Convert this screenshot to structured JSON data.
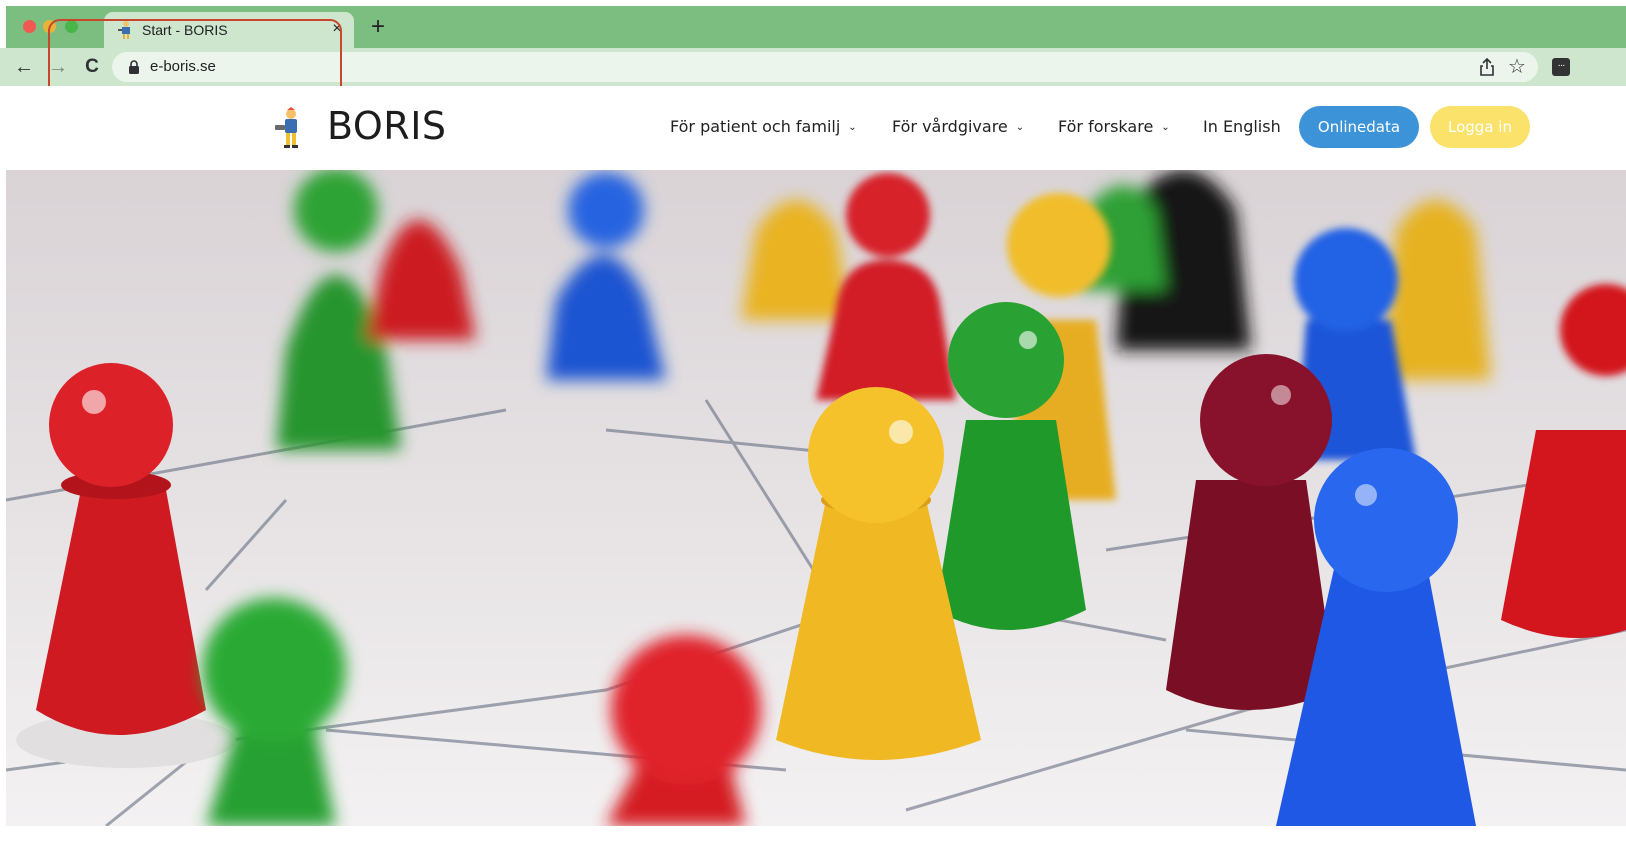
{
  "browser": {
    "tab": {
      "title": "Start - BORIS",
      "close": "×"
    },
    "new_tab": "+",
    "nav": {
      "back": "←",
      "forward": "→",
      "reload": "C"
    },
    "address": {
      "url": "e-boris.se"
    },
    "star": "☆",
    "extension": "···",
    "colors": {
      "chrome": "#7cbe80",
      "toolbar": "#cde6cd",
      "annotation": "#c8462b"
    }
  },
  "site": {
    "logo_text": "BORIS",
    "menu": [
      {
        "label": "För patient och familj",
        "chevron": "⌄"
      },
      {
        "label": "För vårdgivare",
        "chevron": "⌄"
      },
      {
        "label": "För forskare",
        "chevron": "⌄"
      },
      {
        "label": "In English"
      }
    ],
    "buttons": {
      "onlinedata": "Onlinedata",
      "login": "Logga in"
    },
    "colors": {
      "onlinedata": "#3d93d8",
      "login": "#fbe26b"
    }
  },
  "hero": {
    "image": "colorful-game-pawns-on-network-board"
  }
}
